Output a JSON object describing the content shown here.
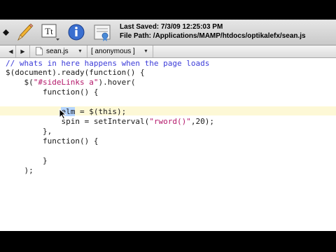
{
  "toolbar": {
    "last_saved_label": "Last Saved:",
    "last_saved_value": "7/3/09 12:25:03 PM",
    "file_path_label": "File Path:",
    "file_path_value": "/Applications/MAMP/htdocs/optikalefx/sean.js",
    "font_button_text": "Tt"
  },
  "nav": {
    "back": "◀",
    "forward": "▶",
    "file_name": "sean.js",
    "function_name": "[ anonymous ]",
    "dropdown": "▼"
  },
  "code": {
    "lines": [
      "// whats in here happens when the page loads",
      "$(document).ready(function() {",
      "    $(\"#sideLinks a\").hover(",
      "        function() {",
      "",
      "            elm = $(this);",
      "            spin = setInterval(\"rword()\",20);",
      "        },",
      "        function() {",
      "",
      "        }",
      "    );"
    ],
    "selected_text": "elm"
  },
  "colors": {
    "comment": "#3b3bd8",
    "string": "#b4186a",
    "current_line": "#fdf8d6",
    "selection": "#b5d5ff"
  }
}
